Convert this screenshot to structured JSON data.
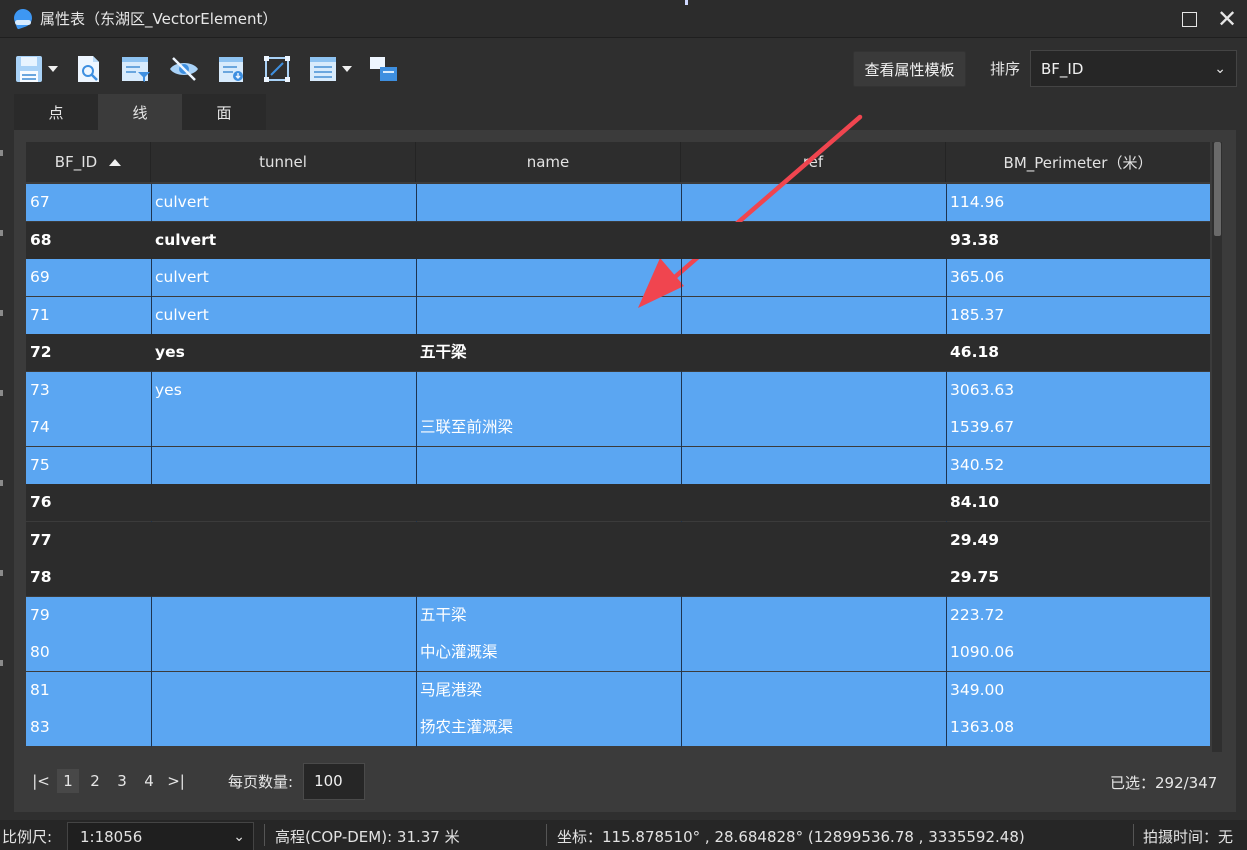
{
  "window": {
    "title": "属性表（东湖区_VectorElement）"
  },
  "toolbar": {
    "icons": [
      "save-icon",
      "zoom-to-icon",
      "filter-icon",
      "hide-icon",
      "export-icon",
      "select-extent-icon",
      "field-list-icon",
      "relate-icon"
    ],
    "template_button": "查看属性模板",
    "sort_label": "排序",
    "sort_value": "BF_ID"
  },
  "tabs": [
    {
      "label": "点",
      "active": false
    },
    {
      "label": "线",
      "active": true
    },
    {
      "label": "面",
      "active": false
    }
  ],
  "table": {
    "columns": [
      "BF_ID",
      "tunnel",
      "name",
      "ref",
      "BM_Perimeter（米）"
    ],
    "sorted_column": "BF_ID",
    "rows": [
      {
        "id": "67",
        "tunnel": "culvert",
        "name": "",
        "ref": "",
        "perimeter": "114.96",
        "selected": true
      },
      {
        "id": "68",
        "tunnel": "culvert",
        "name": "",
        "ref": "",
        "perimeter": "93.38",
        "selected": false
      },
      {
        "id": "69",
        "tunnel": "culvert",
        "name": "",
        "ref": "",
        "perimeter": "365.06",
        "selected": true
      },
      {
        "id": "71",
        "tunnel": "culvert",
        "name": "",
        "ref": "",
        "perimeter": "185.37",
        "selected": true
      },
      {
        "id": "72",
        "tunnel": "yes",
        "name": "五干梁",
        "ref": "",
        "perimeter": "46.18",
        "selected": false
      },
      {
        "id": "73",
        "tunnel": "yes",
        "name": "",
        "ref": "",
        "perimeter": "3063.63",
        "selected": true
      },
      {
        "id": "74",
        "tunnel": "",
        "name": "三联至前洲梁",
        "ref": "",
        "perimeter": "1539.67",
        "selected": true
      },
      {
        "id": "75",
        "tunnel": "",
        "name": "",
        "ref": "",
        "perimeter": "340.52",
        "selected": true
      },
      {
        "id": "76",
        "tunnel": "",
        "name": "",
        "ref": "",
        "perimeter": "84.10",
        "selected": false
      },
      {
        "id": "77",
        "tunnel": "",
        "name": "",
        "ref": "",
        "perimeter": "29.49",
        "selected": false
      },
      {
        "id": "78",
        "tunnel": "",
        "name": "",
        "ref": "",
        "perimeter": "29.75",
        "selected": false
      },
      {
        "id": "79",
        "tunnel": "",
        "name": "五干梁",
        "ref": "",
        "perimeter": "223.72",
        "selected": true
      },
      {
        "id": "80",
        "tunnel": "",
        "name": "中心灌溉渠",
        "ref": "",
        "perimeter": "1090.06",
        "selected": true
      },
      {
        "id": "81",
        "tunnel": "",
        "name": "马尾港梁",
        "ref": "",
        "perimeter": "349.00",
        "selected": true
      },
      {
        "id": "83",
        "tunnel": "",
        "name": "扬农主灌溉渠",
        "ref": "",
        "perimeter": "1363.08",
        "selected": true
      }
    ]
  },
  "pagination": {
    "first": "|<",
    "pages": [
      "1",
      "2",
      "3",
      "4"
    ],
    "current": "1",
    "last": ">|",
    "per_page_label": "每页数量:",
    "per_page_value": "100",
    "selected_count": "已选：292/347"
  },
  "statusbar": {
    "scale_label": "比例尺:",
    "scale_value": "1:18056",
    "elevation": "高程(COP-DEM): 31.37 米",
    "coordinates": "坐标：115.878510° , 28.684828°  (12899536.78 , 3335592.48)",
    "capture_time": "拍摄时间：无"
  },
  "colors": {
    "selected_row": "#5ba6f2",
    "annotation_arrow": "#f0454f"
  }
}
